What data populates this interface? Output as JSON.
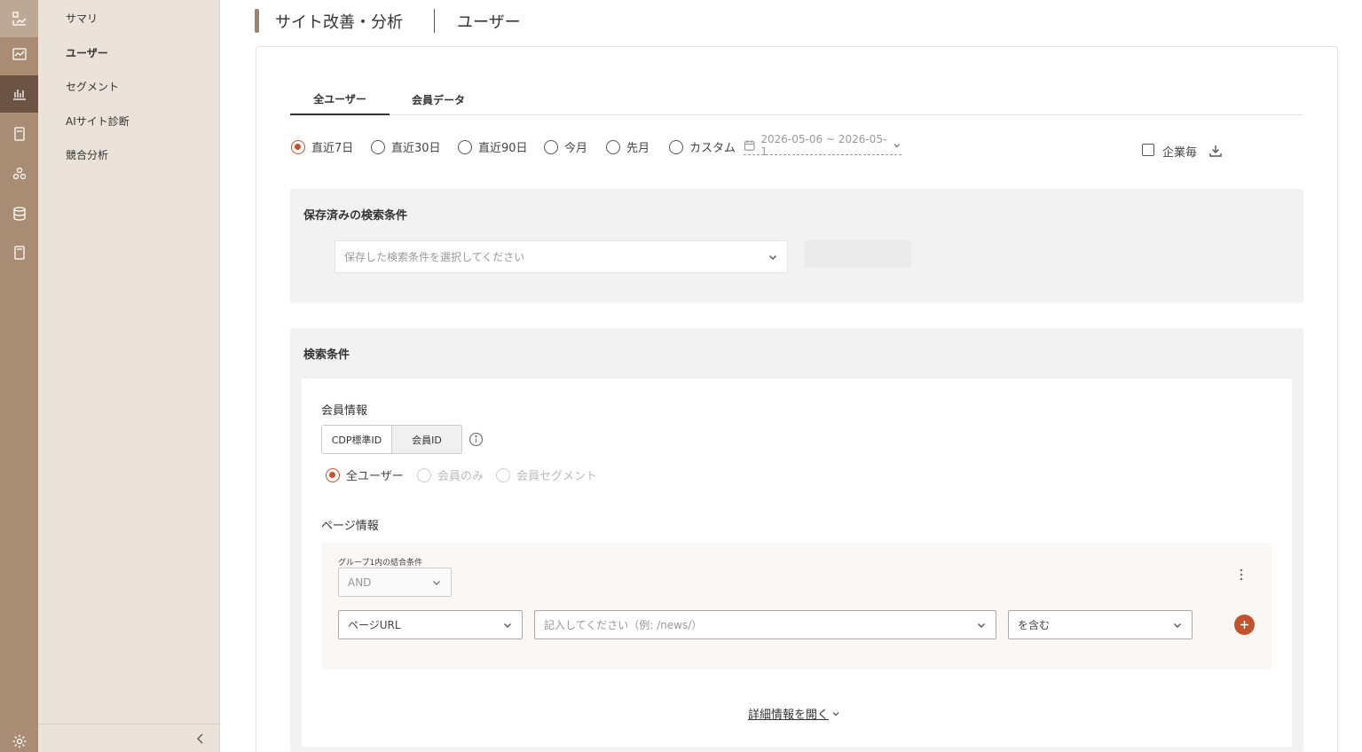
{
  "rail": {
    "items": [
      {
        "icon": "chart-network-icon"
      },
      {
        "icon": "line-chart-icon"
      },
      {
        "icon": "bar-chart-icon"
      },
      {
        "icon": "document-icon"
      },
      {
        "icon": "users-icon"
      },
      {
        "icon": "database-icon"
      },
      {
        "icon": "book-icon"
      }
    ],
    "settings_icon": "gear-icon"
  },
  "subnav": {
    "items": [
      {
        "label": "サマリ"
      },
      {
        "label": "ユーザー"
      },
      {
        "label": "セグメント"
      },
      {
        "label": "AIサイト診断"
      },
      {
        "label": "競合分析"
      }
    ]
  },
  "header": {
    "title": "サイト改善・分析",
    "subtitle": "ユーザー"
  },
  "tabs": [
    {
      "label": "全ユーザー"
    },
    {
      "label": "会員データ"
    }
  ],
  "period": {
    "options": [
      {
        "label": "直近7日"
      },
      {
        "label": "直近30日"
      },
      {
        "label": "直近90日"
      },
      {
        "label": "今月"
      },
      {
        "label": "先月"
      },
      {
        "label": "カスタム"
      }
    ],
    "date_range": "2026-05-06 ~ 2026-05-1"
  },
  "per_company": {
    "label": "企業毎"
  },
  "saved": {
    "title": "保存済みの検索条件",
    "placeholder": "保存した検索条件を選択してください"
  },
  "search": {
    "title": "検索条件",
    "member_info_label": "会員情報",
    "id_toggle": [
      {
        "label": "CDP標準ID"
      },
      {
        "label": "会員ID"
      }
    ],
    "user_scope": [
      {
        "label": "全ユーザー"
      },
      {
        "label": "会員のみ"
      },
      {
        "label": "会員セグメント"
      }
    ],
    "page_info_label": "ページ情報",
    "group_label": "グループ1内の結合条件",
    "combine_value": "AND",
    "field_value": "ページURL",
    "value_placeholder": "記入してください（例: /news/）",
    "operator_value": "を含む",
    "details_link": "詳細情報を開く"
  },
  "colors": {
    "accent": "#c4522e",
    "rail": "#a88c74",
    "rail_active": "#6b5443",
    "subnav_bg": "#ebe3da"
  }
}
